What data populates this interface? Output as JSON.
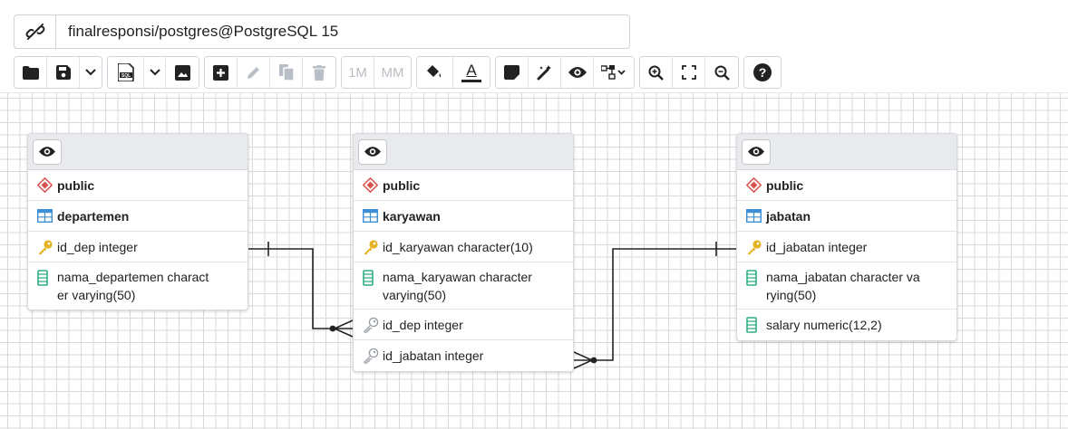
{
  "connection": {
    "icon": "disconnected-link-icon",
    "title": "finalresponsi/postgres@PostgreSQL 15"
  },
  "toolbar": {
    "zoom_text_1m": "1M",
    "zoom_text_mm": "MM",
    "font_color_glyph": "A"
  },
  "tables": [
    {
      "id": "departemen",
      "schema": "public",
      "name": "departemen",
      "columns": [
        {
          "kind": "primary-key",
          "text": "id_dep integer"
        },
        {
          "kind": "column",
          "text": "nama_departemen charact er varying(50)",
          "line1": "nama_departemen charact",
          "line2": "er varying(50)"
        }
      ]
    },
    {
      "id": "karyawan",
      "schema": "public",
      "name": "karyawan",
      "columns": [
        {
          "kind": "primary-key",
          "text": "id_karyawan character(10)"
        },
        {
          "kind": "column",
          "text": "nama_karyawan character varying(50)",
          "line1": "nama_karyawan character",
          "line2": "varying(50)"
        },
        {
          "kind": "foreign-key",
          "text": "id_dep integer"
        },
        {
          "kind": "foreign-key",
          "text": "id_jabatan integer"
        }
      ]
    },
    {
      "id": "jabatan",
      "schema": "public",
      "name": "jabatan",
      "columns": [
        {
          "kind": "primary-key",
          "text": "id_jabatan integer"
        },
        {
          "kind": "column",
          "text": "nama_jabatan character va rying(50)",
          "line1": "nama_jabatan character va",
          "line2": "rying(50)"
        },
        {
          "kind": "column",
          "text": "salary numeric(12,2)"
        }
      ]
    }
  ],
  "relations": [
    {
      "from": "departemen.id_dep",
      "to": "karyawan.id_dep",
      "type": "one-to-many"
    },
    {
      "from": "jabatan.id_jabatan",
      "to": "karyawan.id_jabatan",
      "type": "one-to-many"
    }
  ],
  "colors": {
    "schema_icon": "#d9534f",
    "table_icon": "#3d8fd6",
    "key_icon": "#e6b422",
    "fk_icon": "#9aa0a6",
    "column_icon": "#2eae86",
    "grid": "#d9d9d9"
  }
}
